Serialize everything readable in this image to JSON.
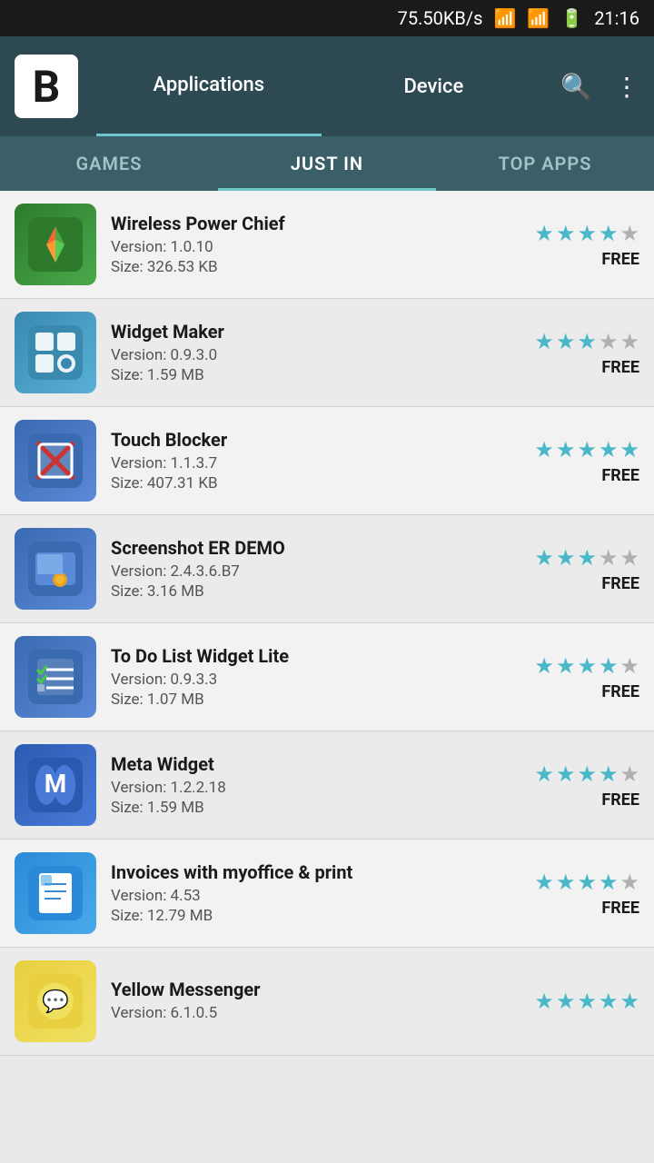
{
  "statusBar": {
    "speed": "75.50KB/s",
    "time": "21:16"
  },
  "header": {
    "logo": "B",
    "tabs": [
      {
        "label": "Applications",
        "active": true
      },
      {
        "label": "Device",
        "active": false
      }
    ],
    "searchIcon": "🔍",
    "moreIcon": "⋮"
  },
  "subTabs": [
    {
      "label": "GAMES",
      "active": false
    },
    {
      "label": "JUST IN",
      "active": true
    },
    {
      "label": "TOP APPS",
      "active": false
    }
  ],
  "apps": [
    {
      "name": "Wireless Power Chief",
      "version": "Version: 1.0.10",
      "size": "Size: 326.53 KB",
      "stars": 4,
      "price": "FREE",
      "iconClass": "icon-wireless",
      "iconSymbol": "🌿"
    },
    {
      "name": "Widget Maker",
      "version": "Version: 0.9.3.0",
      "size": "Size: 1.59 MB",
      "stars": 3,
      "price": "FREE",
      "iconClass": "icon-widget",
      "iconSymbol": "⚙"
    },
    {
      "name": "Touch Blocker",
      "version": "Version: 1.1.3.7",
      "size": "Size: 407.31 KB",
      "stars": 5,
      "price": "FREE",
      "iconClass": "icon-touch",
      "iconSymbol": "🚫"
    },
    {
      "name": "Screenshot ER DEMO",
      "version": "Version: 2.4.3.6.B7",
      "size": "Size: 3.16 MB",
      "stars": 3,
      "price": "FREE",
      "iconClass": "icon-screenshot",
      "iconSymbol": "📷"
    },
    {
      "name": "To Do List Widget Lite",
      "version": "Version: 0.9.3.3",
      "size": "Size: 1.07 MB",
      "stars": 4,
      "price": "FREE",
      "iconClass": "icon-todo",
      "iconSymbol": "✅"
    },
    {
      "name": "Meta Widget",
      "version": "Version: 1.2.2.18",
      "size": "Size: 1.59 MB",
      "stars": 4,
      "price": "FREE",
      "iconClass": "icon-meta",
      "iconSymbol": "M"
    },
    {
      "name": "Invoices with myoffice & print",
      "version": "Version: 4.53",
      "size": "Size: 12.79 MB",
      "stars": 4,
      "price": "FREE",
      "iconClass": "icon-invoices",
      "iconSymbol": "📄"
    },
    {
      "name": "Yellow Messenger",
      "version": "Version: 6.1.0.5",
      "size": "",
      "stars": 5,
      "price": "",
      "iconClass": "icon-yellow",
      "iconSymbol": "💬"
    }
  ]
}
